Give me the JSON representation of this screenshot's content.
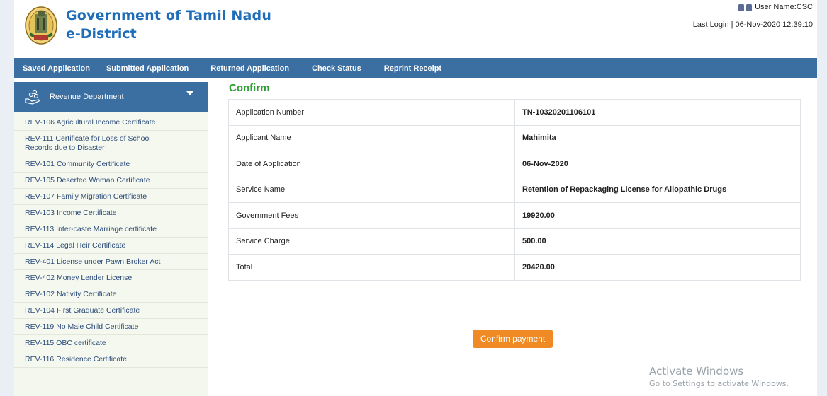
{
  "header": {
    "title": "Government of Tamil Nadu",
    "subtitle": "e-District",
    "user_name": "User Name:CSC",
    "last_login": "Last Login | 06-Nov-2020 12:39:10"
  },
  "nav": {
    "items": [
      "Saved Application",
      "Submitted Application",
      "Returned Application",
      "Check Status",
      "Reprint Receipt"
    ]
  },
  "sidebar": {
    "department": "Revenue Department",
    "items": [
      "REV-106 Agricultural Income Certificate",
      "REV-111 Certificate for Loss of School Records due to Disaster",
      "REV-101 Community Certificate",
      "REV-105 Deserted Woman Certificate",
      "REV-107 Family Migration Certificate",
      "REV-103 Income Certificate",
      "REV-113 Inter-caste Marriage certificate",
      "REV-114 Legal Heir Certificate",
      "REV-401 License under Pawn Broker Act",
      "REV-402 Money Lender License",
      "REV-102 Nativity Certificate",
      "REV-104 First Graduate Certificate",
      "REV-119 No Male Child Certificate",
      "REV-115 OBC certificate",
      "REV-116 Residence Certificate"
    ]
  },
  "main": {
    "heading": "Confirm",
    "rows": [
      {
        "label": "Application Number",
        "value": "TN-10320201106101"
      },
      {
        "label": "Applicant Name",
        "value": "Mahimita"
      },
      {
        "label": "Date of Application",
        "value": "06-Nov-2020"
      },
      {
        "label": "Service Name",
        "value": "Retention of Repackaging License for Allopathic Drugs"
      },
      {
        "label": "Government Fees",
        "value": "19920.00"
      },
      {
        "label": "Service Charge",
        "value": "500.00"
      },
      {
        "label": "Total",
        "value": "20420.00"
      }
    ],
    "confirm_button": "Confirm payment"
  },
  "watermark": {
    "title": "Activate Windows",
    "subtitle": "Go to Settings to activate Windows."
  }
}
